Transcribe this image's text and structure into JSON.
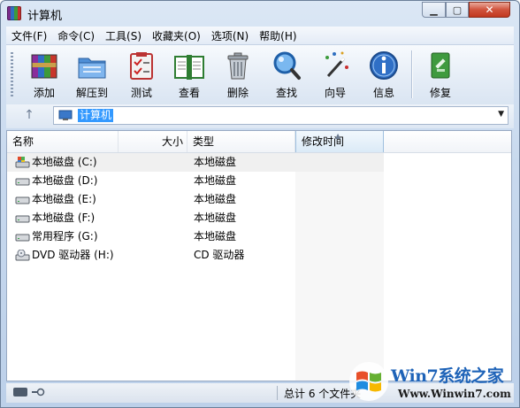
{
  "window": {
    "title": "计算机"
  },
  "menu": [
    "文件(F)",
    "命令(C)",
    "工具(S)",
    "收藏夹(O)",
    "选项(N)",
    "帮助(H)"
  ],
  "toolbar": {
    "add": "添加",
    "extract": "解压到",
    "test": "测试",
    "view": "查看",
    "delete": "删除",
    "find": "查找",
    "wizard": "向导",
    "info": "信息",
    "repair": "修复"
  },
  "address": {
    "path": "计算机"
  },
  "columns": {
    "name": "名称",
    "size": "大小",
    "type": "类型",
    "modified": "修改时间"
  },
  "files": [
    {
      "name": "本地磁盘 (C:)",
      "type": "本地磁盘",
      "icon": "system-drive-icon"
    },
    {
      "name": "本地磁盘 (D:)",
      "type": "本地磁盘",
      "icon": "hard-drive-icon"
    },
    {
      "name": "本地磁盘 (E:)",
      "type": "本地磁盘",
      "icon": "hard-drive-icon"
    },
    {
      "name": "本地磁盘 (F:)",
      "type": "本地磁盘",
      "icon": "hard-drive-icon"
    },
    {
      "name": "常用程序 (G:)",
      "type": "本地磁盘",
      "icon": "hard-drive-icon"
    },
    {
      "name": "DVD 驱动器 (H:)",
      "type": "CD 驱动器",
      "icon": "dvd-drive-icon"
    }
  ],
  "status": {
    "summary": "总计 6 个文件夹"
  },
  "watermark": {
    "brand": "Win7系统之家",
    "url": "Www.Winwin7.com"
  },
  "colors": {
    "selection": "#3399ff",
    "accent": "#1e63b8"
  }
}
